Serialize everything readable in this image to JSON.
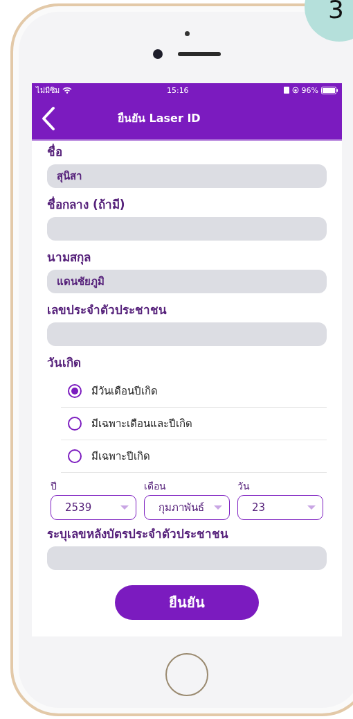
{
  "step_badge": "3",
  "status_bar": {
    "carrier": "ไม่มีซิม",
    "time": "15:16",
    "battery": "96%"
  },
  "nav": {
    "title": "ยืนยัน Laser ID"
  },
  "fields_top": [
    {
      "label": "ชื่อ",
      "value": "สุนิสา"
    },
    {
      "label": "ชื่อกลาง (ถ้ามี)"
    },
    {
      "label": "นามสกุล",
      "value": "แดนชัยภูมิ"
    },
    {
      "label": "เลขประจำตัวประชาชน"
    }
  ],
  "birth": {
    "label": "วันเกิด",
    "options": [
      {
        "label": "มีวันเดือนปีเกิด",
        "selected": true
      },
      {
        "label": "มีเฉพาะเดือนและปีเกิด",
        "selected": false
      },
      {
        "label": "มีเฉพาะปีเกิด",
        "selected": false
      }
    ],
    "selects": [
      {
        "label": "ปี",
        "value": "2539"
      },
      {
        "label": "เดือน",
        "value": "กุมภาพันธ์"
      },
      {
        "label": "วัน",
        "value": "23"
      }
    ]
  },
  "fields_bottom": [
    {
      "label": "ระบุเลขหลังบัตรประจำตัวประชาชน"
    }
  ],
  "submit": "ยืนยัน"
}
